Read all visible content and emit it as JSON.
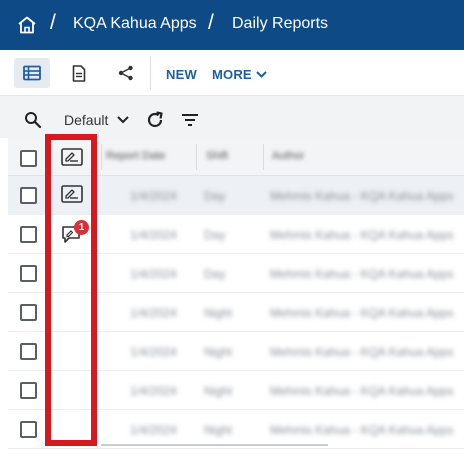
{
  "breadcrumb": {
    "separator": "/",
    "items": [
      "KQA Kahua Apps",
      "Daily Reports"
    ]
  },
  "toolbar": {
    "new_label": "NEW",
    "more_label": "MORE"
  },
  "viewbar": {
    "view_name": "Default"
  },
  "grid": {
    "headers": [
      "Report Date",
      "Shift",
      "Author"
    ],
    "rows": [
      {
        "date": "1/4/2024",
        "shift": "Day",
        "author": "Mehmis Kahua - KQA Kahua Apps",
        "icon": "report-icon",
        "selected": true
      },
      {
        "date": "1/4/2024",
        "shift": "Day",
        "author": "Mehmis Kahua - KQA Kahua Apps",
        "icon": "comment-icon",
        "badge": "1",
        "selected": false
      },
      {
        "date": "1/4/2024",
        "shift": "Day",
        "author": "Mehmis Kahua - KQA Kahua Apps",
        "icon": "",
        "selected": false
      },
      {
        "date": "1/4/2024",
        "shift": "Night",
        "author": "Mehmis Kahua - KQA Kahua Apps",
        "icon": "",
        "selected": false
      },
      {
        "date": "1/4/2024",
        "shift": "Night",
        "author": "Mehmis Kahua - KQA Kahua Apps",
        "icon": "",
        "selected": false
      },
      {
        "date": "1/4/2024",
        "shift": "Night",
        "author": "Mehmis Kahua - KQA Kahua Apps",
        "icon": "",
        "selected": false
      },
      {
        "date": "1/4/2024",
        "shift": "Night",
        "author": "Mehmis Kahua - KQA Kahua Apps",
        "icon": "",
        "selected": false
      }
    ]
  },
  "colors": {
    "topbar": "#0d4a86",
    "accent": "#1d5fa6",
    "highlight": "#d7191f",
    "badge": "#d6313a"
  }
}
